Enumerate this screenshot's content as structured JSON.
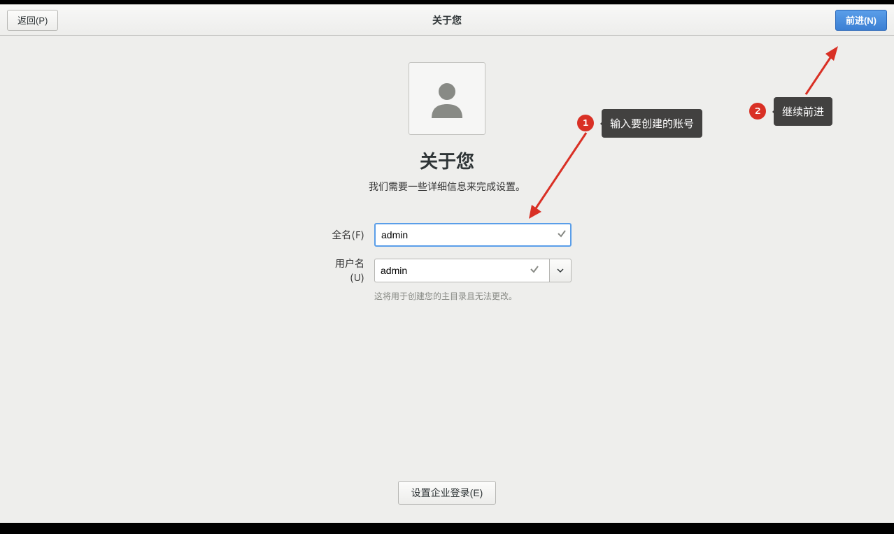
{
  "header": {
    "back_label": "返回(P)",
    "forward_label": "前进(N)",
    "title": "关于您"
  },
  "main": {
    "heading": "关于您",
    "subheading": "我们需要一些详细信息来完成设置。"
  },
  "form": {
    "fullname": {
      "label": "全名(F)",
      "value": "admin"
    },
    "username": {
      "label": "用户名(U)",
      "value": "admin",
      "hint": "这将用于创建您的主目录且无法更改。"
    }
  },
  "enterprise": {
    "button_label": "设置企业登录(E)"
  },
  "annotations": {
    "a1": {
      "num": "1",
      "text": "输入要创建的账号"
    },
    "a2": {
      "num": "2",
      "text": "继续前进"
    }
  },
  "colors": {
    "accent": "#5a9ee9",
    "danger": "#d93025"
  }
}
